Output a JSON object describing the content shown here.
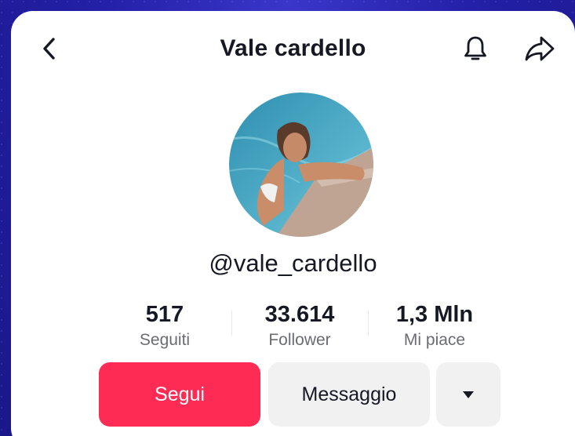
{
  "header": {
    "title": "Vale cardello"
  },
  "icons": {
    "back": "chevron-left-icon",
    "bell": "bell-icon",
    "share": "share-arrow-icon",
    "more": "caret-down-icon"
  },
  "profile": {
    "username": "@vale_cardello"
  },
  "stats": [
    {
      "value": "517",
      "label": "Seguiti"
    },
    {
      "value": "33.614",
      "label": "Follower"
    },
    {
      "value": "1,3 Mln",
      "label": "Mi piace"
    }
  ],
  "actions": {
    "follow_label": "Segui",
    "message_label": "Messaggio",
    "more_symbol": "▼"
  },
  "colors": {
    "background": "#2420a8",
    "card": "#ffffff",
    "follow_button": "#fe2c55",
    "secondary_button": "#f1f1f2",
    "text_primary": "#161823",
    "text_secondary": "#6b6c72"
  }
}
